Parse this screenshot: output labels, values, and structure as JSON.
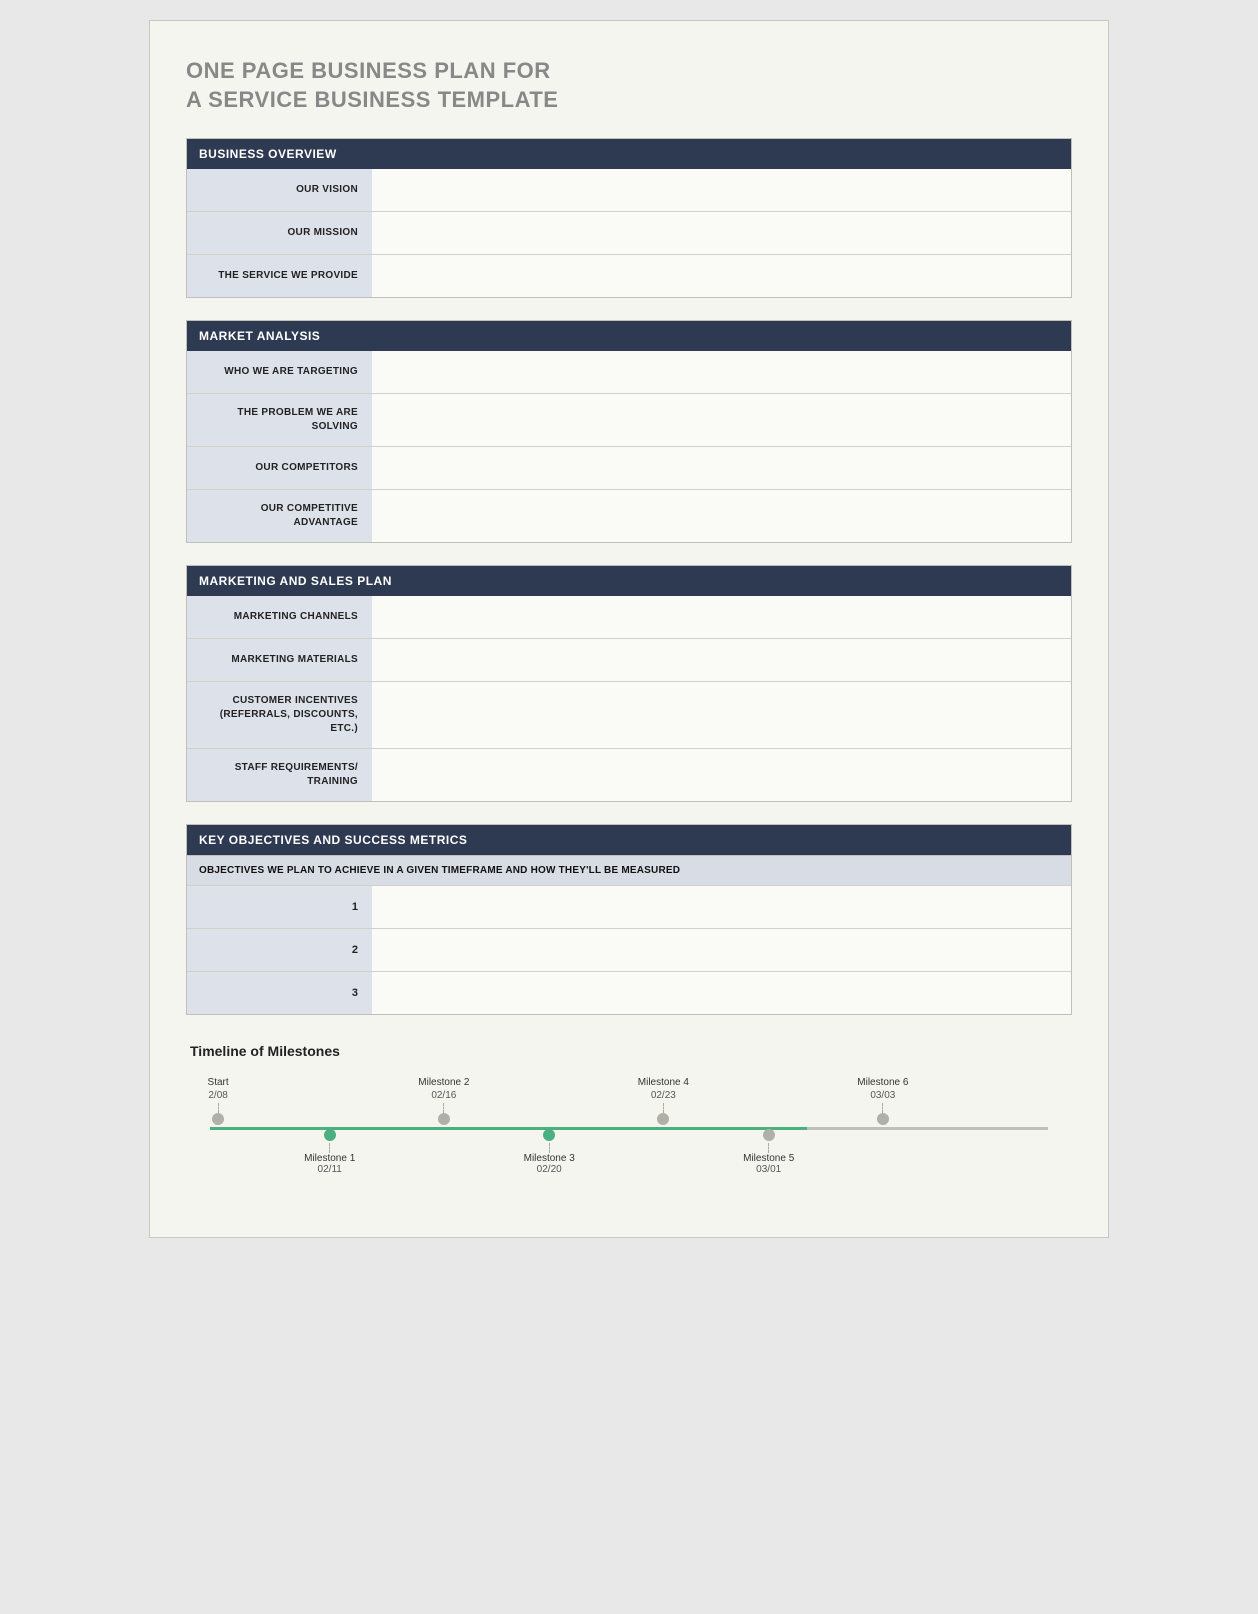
{
  "title": {
    "line1": "ONE PAGE BUSINESS PLAN FOR",
    "line2": "A SERVICE BUSINESS TEMPLATE"
  },
  "sections": {
    "business_overview": {
      "header": "BUSINESS OVERVIEW",
      "rows": [
        {
          "label": "OUR VISION",
          "content": ""
        },
        {
          "label": "OUR MISSION",
          "content": ""
        },
        {
          "label": "THE SERVICE WE PROVIDE",
          "content": ""
        }
      ]
    },
    "market_analysis": {
      "header": "MARKET ANALYSIS",
      "rows": [
        {
          "label": "WHO WE ARE TARGETING",
          "content": ""
        },
        {
          "label": "THE PROBLEM WE ARE SOLVING",
          "content": ""
        },
        {
          "label": "OUR COMPETITORS",
          "content": ""
        },
        {
          "label": "OUR COMPETITIVE ADVANTAGE",
          "content": ""
        }
      ]
    },
    "marketing_sales": {
      "header": "MARKETING AND SALES PLAN",
      "rows": [
        {
          "label": "MARKETING CHANNELS",
          "content": ""
        },
        {
          "label": "MARKETING MATERIALS",
          "content": ""
        },
        {
          "label": "CUSTOMER INCENTIVES (REFERRALS, DISCOUNTS, ETC.)",
          "content": ""
        },
        {
          "label": "STAFF REQUIREMENTS/ TRAINING",
          "content": ""
        }
      ]
    },
    "key_objectives": {
      "header": "KEY OBJECTIVES AND SUCCESS METRICS",
      "subheader": "OBJECTIVES WE PLAN TO ACHIEVE IN A GIVEN TIMEFRAME AND HOW THEY'LL BE MEASURED",
      "rows": [
        {
          "num": "1",
          "content": ""
        },
        {
          "num": "2",
          "content": ""
        },
        {
          "num": "3",
          "content": ""
        }
      ]
    }
  },
  "timeline": {
    "title": "Timeline of Milestones",
    "milestones_top": [
      {
        "label": "Start",
        "date": "2/08",
        "position": 2
      },
      {
        "label": "Milestone 2",
        "date": "02/16",
        "position": 27
      },
      {
        "label": "Milestone 4",
        "date": "02/23",
        "position": 52
      },
      {
        "label": "Milestone 6",
        "date": "03/03",
        "position": 77
      }
    ],
    "milestones_bottom": [
      {
        "label": "Milestone 1",
        "date": "02/11",
        "position": 15,
        "green": true
      },
      {
        "label": "Milestone 3",
        "date": "02/20",
        "position": 40,
        "green": true
      },
      {
        "label": "Milestone 5",
        "date": "03/01",
        "position": 65,
        "green": false
      }
    ]
  }
}
